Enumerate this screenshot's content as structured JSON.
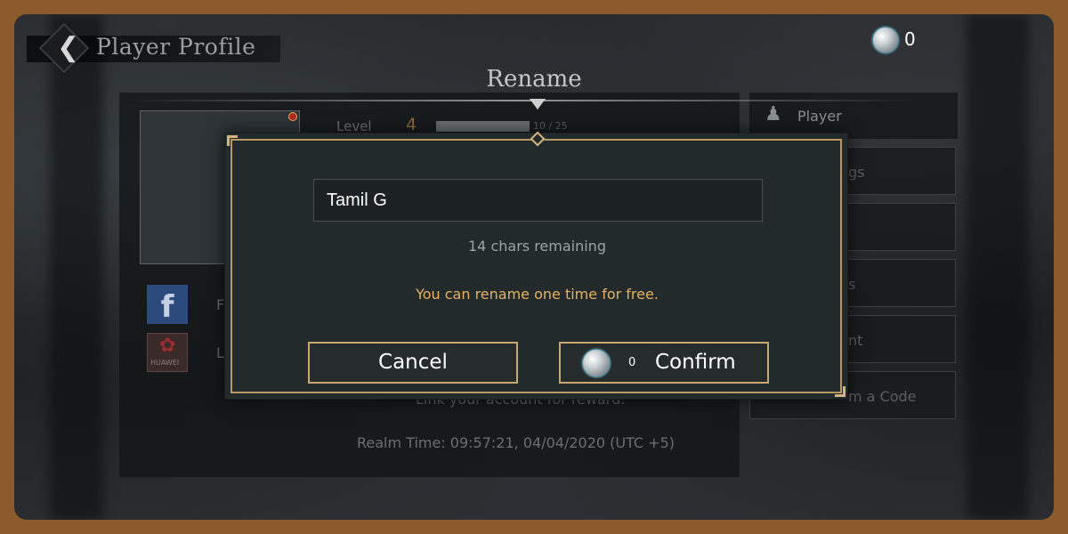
{
  "header": {
    "page_title": "Player Profile",
    "currency_amount": "0"
  },
  "dialog": {
    "title": "Rename",
    "name_value": "Tamil G",
    "chars_remaining": "14 chars remaining",
    "free_note": "You can rename one time for free.",
    "cancel_label": "Cancel",
    "confirm_cost": "0",
    "confirm_label": "Confirm"
  },
  "background": {
    "level_label": "Level",
    "level_value": "4",
    "xp_text": "10 / 25",
    "player_tab": "Player",
    "side_buttons": [
      "gs",
      "",
      "s",
      "nt",
      "m a Code"
    ],
    "facebook_label": "F",
    "huawei_label": "L",
    "huawei_text": "HUAWEI",
    "link_reward": "Link your account for reward.",
    "realm_time": "Realm Time: 09:57:21, 04/04/2020 (UTC +5)"
  },
  "colors": {
    "gold_border": "#c8a86e",
    "note_text": "#e6b262",
    "frame_bg": "#8a5a2b"
  }
}
